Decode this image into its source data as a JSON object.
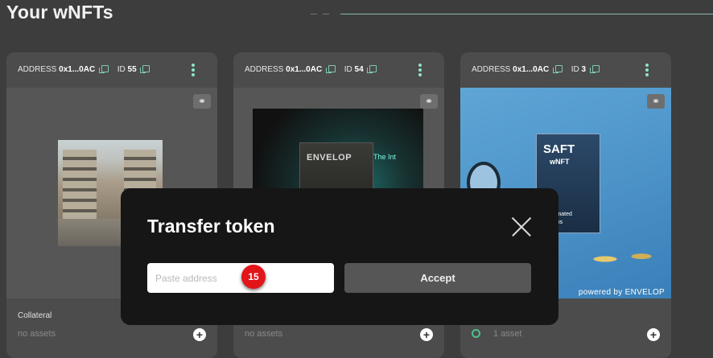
{
  "page": {
    "title": "Your wNFTs"
  },
  "cards": [
    {
      "address_label": "ADDRESS",
      "address": "0x1...0AC",
      "id_label": "ID",
      "id": "55",
      "footer_label": "Collateral",
      "assets": "no assets"
    },
    {
      "address_label": "ADDRESS",
      "address": "0x1...0AC",
      "id_label": "ID",
      "id": "54",
      "artwork_text": "ENVELOP",
      "artwork_text_2": "The Int",
      "assets": "no assets"
    },
    {
      "address_label": "ADDRESS",
      "address": "0x1...0AC",
      "id_label": "ID",
      "id": "3",
      "artwork_text": "SAFT",
      "artwork_text_2": "wNFT",
      "artwork_text_3": "Automated",
      "artwork_text_4": "Tokens",
      "artwork_caption": "powered by ENVELOP",
      "assets": "1 asset"
    }
  ],
  "modal": {
    "title": "Transfer token",
    "address_placeholder": "Paste address",
    "accept_label": "Accept",
    "badge": "15"
  },
  "colors": {
    "accent": "#8ee3c8",
    "badge": "#e2151b",
    "modal_bg": "#161616",
    "card_bg": "#4c4c4c"
  },
  "icons": {
    "copy": "copy-icon",
    "menu": "kebab-icon",
    "link": "link-icon",
    "add": "plus-icon",
    "close": "close-icon",
    "token": "token-icon"
  }
}
